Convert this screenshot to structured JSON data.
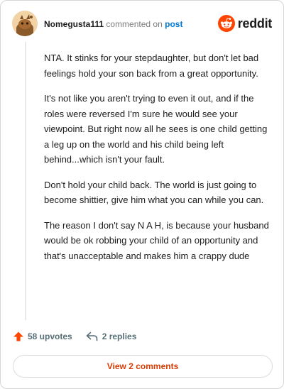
{
  "header": {
    "username": "Nomegusta111",
    "action_text": "commented on",
    "link_text": "post",
    "brand": "reddit"
  },
  "comment": {
    "paragraphs": [
      "NTA. It stinks for your stepdaughter, but don't let bad feelings hold your son back from a great opportunity.",
      "It's not like you aren't trying to even it out, and if the roles were reversed I'm sure he would see your viewpoint. But right now all he sees is one child getting a leg up on the world and his child being left behind...which isn't your fault.",
      "Don't hold your child back. The world is just going to become shittier, give him what you can while you can.",
      "The reason I don't say N A H, is because your husband would be ok robbing your child of an opportunity and that's unacceptable and makes him a crappy dude"
    ]
  },
  "actions": {
    "upvotes_label": "58 upvotes",
    "replies_label": "2 replies"
  },
  "footer": {
    "view_comments_label": "View 2 comments"
  },
  "icons": {
    "upvote": "upvote-arrow-icon",
    "reply": "reply-arrow-icon",
    "brand": "reddit-snoo-icon"
  },
  "colors": {
    "upvote": "#ff4500",
    "brand": "#ff4500",
    "link": "#0079d3",
    "view_comments": "#d93a00"
  }
}
